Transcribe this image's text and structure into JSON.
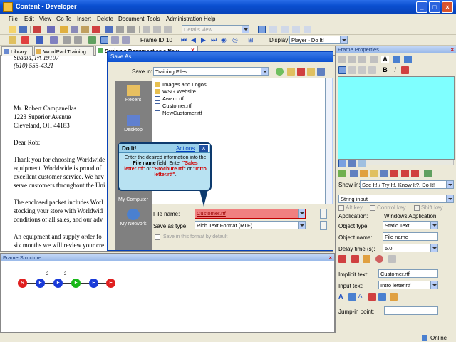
{
  "title": "Content - Developer",
  "menu": [
    "File",
    "Edit",
    "View",
    "Go To",
    "Insert",
    "Delete",
    "Document",
    "Tools",
    "Administration",
    "Help"
  ],
  "toolbar2": {
    "view_combo": "Details view",
    "frame_id_label": "Frame ID:",
    "frame_id": "10",
    "display_label": "Display:",
    "display_value": "Player - Do It!"
  },
  "tabs": [
    {
      "label": "Library"
    },
    {
      "label": "WordPad Training"
    },
    {
      "label": "Saving a Document as a New ..."
    }
  ],
  "document": {
    "lines": [
      "Suaaia, PA 19107",
      "(610) 555-4321",
      "Mr. Robert Campanellas",
      "1223 Superior Avenue",
      "Cleveland, OH  44183",
      "Dear Rob:",
      "Thank you for choosing Worldwide",
      "equipment. Worldwide is proud of",
      "excellent customer service. We hav",
      "serve customers throughout the Uni",
      "The enclosed packet includes Worl",
      "stocking your store with Worldwid",
      "conditions of all sales, and our adv",
      "An equipment and supply order fo",
      "six months we will review your cre"
    ]
  },
  "save_dialog": {
    "title": "Save As",
    "save_in_label": "Save in:",
    "save_in_value": "Training Files",
    "places": [
      "Recent",
      "Desktop",
      "My Computer",
      "My Network"
    ],
    "files": [
      "Images and Logos",
      "WSG Website",
      "Award.rtf",
      "Customer.rtf",
      "NewCustomer.rtf"
    ],
    "file_name_label": "File name:",
    "file_name_value": "Customer.rtf",
    "save_type_label": "Save as type:",
    "save_type_value": "Rich Text Format (RTF)",
    "default_label": "Save in this format by default"
  },
  "popup": {
    "title": "Do It!",
    "actions": "Actions",
    "text1": "Enter the desired information into the ",
    "bold1": "File name",
    "text2": " field. Enter",
    "opt1": "\"Sales letter.rtf\"",
    "or1": " or ",
    "opt2": "\"Brochure.rtf\"",
    "or2": " or ",
    "opt3": "\"Intro letter.rtf\"",
    "end": "."
  },
  "frame_properties": {
    "title": "Frame Properties",
    "show_in_label": "Show in:",
    "show_in_value": "See It! / Try It!, Know It?, Do It!",
    "frame_type": "String input",
    "alt_key": "Alt key",
    "control_key": "Control key",
    "shift_key": "Shift key",
    "application_label": "Application:",
    "application_value": "Windows Application",
    "object_type_label": "Object type:",
    "object_type_value": "Static Text",
    "object_name_label": "Object name:",
    "object_name_value": "File name",
    "delay_label": "Delay time (s):",
    "delay_value": "5.0",
    "implicit_label": "Implicit text:",
    "implicit_value": "Customer.rtf",
    "input_label": "Input text:",
    "input_value": "Intro letter.rtf",
    "jump_label": "Jump-in point:"
  },
  "frame_structure": {
    "title": "Frame Structure",
    "nodes": [
      "S",
      "F",
      "F",
      "F",
      "F",
      "F",
      "E"
    ],
    "branch_labels": [
      "2",
      "2"
    ]
  },
  "status": {
    "online": "Online"
  },
  "colors": {
    "accent": "#0842b8",
    "node_start": "#e02020",
    "node_frame": "#1a3bd8",
    "node_active": "#18b818",
    "file_highlight": "#f08080",
    "editor_bg": "#7fffff"
  }
}
